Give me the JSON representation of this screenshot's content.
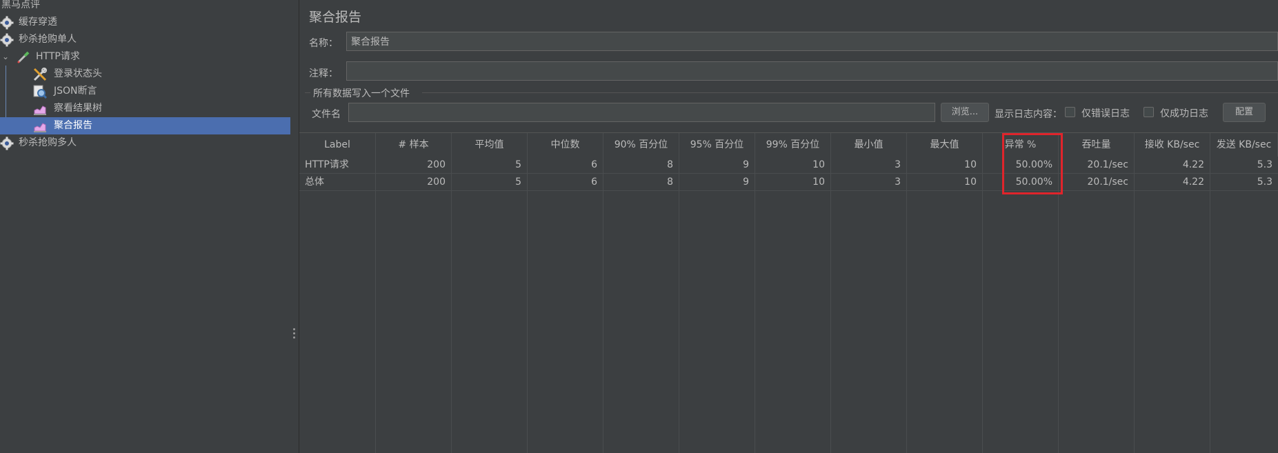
{
  "tree": {
    "root": "黑马点评",
    "nodes": [
      {
        "label": "缓存穿透",
        "icon": "gear-icon"
      },
      {
        "label": "秒杀抢购单人",
        "icon": "gear-icon"
      },
      {
        "label": "HTTP请求",
        "icon": "pipette-icon"
      },
      {
        "label": "登录状态头",
        "icon": "wrench-icon"
      },
      {
        "label": "JSON断言",
        "icon": "magnifier-icon"
      },
      {
        "label": "察看结果树",
        "icon": "chart-icon"
      },
      {
        "label": "聚合报告",
        "icon": "chart-icon"
      },
      {
        "label": "秒杀抢购多人",
        "icon": "gear-icon"
      }
    ],
    "selected_index": 6
  },
  "panel": {
    "title": "聚合报告",
    "name_label": "名称：",
    "name_value": "聚合报告",
    "comment_label": "注释：",
    "comment_value": "",
    "section_title": "所有数据写入一个文件",
    "filename_label": "文件名",
    "filename_value": "",
    "browse_button": "浏览...",
    "log_label": "显示日志内容：",
    "errors_only_label": "仅错误日志",
    "success_only_label": "仅成功日志",
    "config_button": "配置"
  },
  "table": {
    "columns": [
      "Label",
      "# 样本",
      "平均值",
      "中位数",
      "90% 百分位",
      "95% 百分位",
      "99% 百分位",
      "最小值",
      "最大值",
      "异常 %",
      "吞吐量",
      "接收 KB/sec",
      "发送 KB/sec"
    ],
    "rows": [
      [
        "HTTP请求",
        "200",
        "5",
        "6",
        "8",
        "9",
        "10",
        "3",
        "10",
        "50.00%",
        "20.1/sec",
        "4.22",
        "5.3"
      ],
      [
        "总体",
        "200",
        "5",
        "6",
        "8",
        "9",
        "10",
        "3",
        "10",
        "50.00%",
        "20.1/sec",
        "4.22",
        "5.3"
      ]
    ]
  },
  "colors": {
    "background": "#3c3f41",
    "selection": "#4b6eaf",
    "highlight_box": "#e0242b"
  }
}
